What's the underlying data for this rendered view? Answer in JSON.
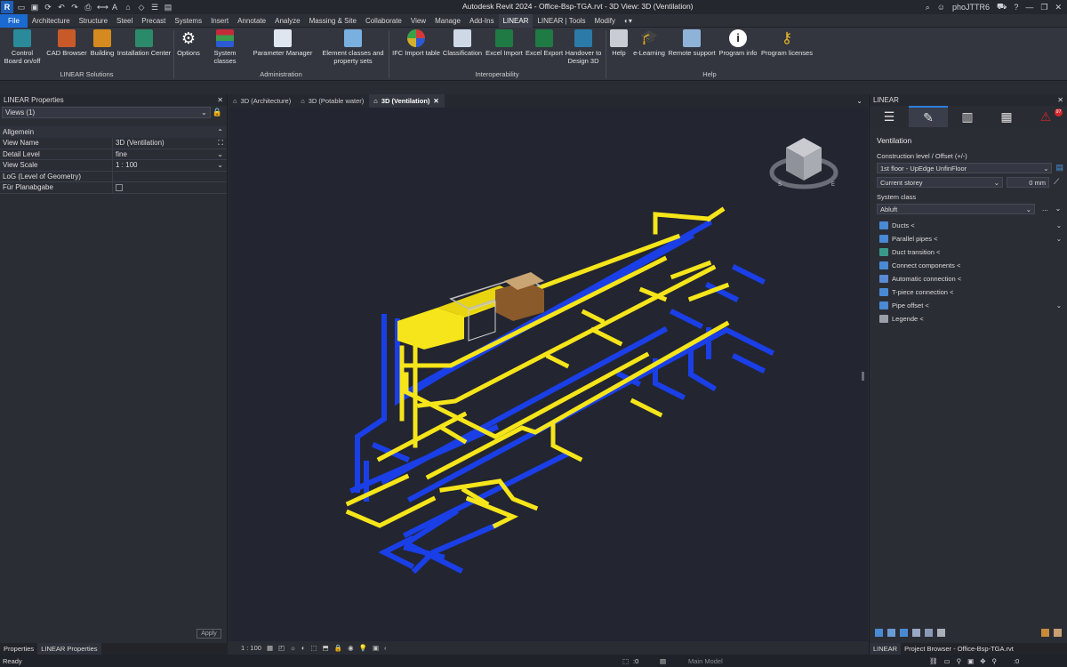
{
  "app": {
    "logo": "R",
    "title": "Autodesk Revit 2024 - Office-Bsp-TGA.rvt - 3D View: 3D (Ventilation)",
    "user": "phoJTTR6"
  },
  "menu": [
    "File",
    "Architecture",
    "Structure",
    "Steel",
    "Precast",
    "Systems",
    "Insert",
    "Annotate",
    "Analyze",
    "Massing & Site",
    "Collaborate",
    "View",
    "Manage",
    "Add-Ins",
    "LINEAR",
    "LINEAR | Tools",
    "Modify"
  ],
  "ribbon": {
    "buttons": [
      {
        "label": "Control Board on/off"
      },
      {
        "label": "CAD Browser"
      },
      {
        "label": "Building"
      },
      {
        "label": "Installation Center"
      },
      {
        "label": "Options"
      },
      {
        "label": "System classes"
      },
      {
        "label": "Parameter Manager"
      },
      {
        "label": "Element classes and property sets"
      },
      {
        "label": "IFC Import table"
      },
      {
        "label": "Classification"
      },
      {
        "label": "Excel Import"
      },
      {
        "label": "Excel Export"
      },
      {
        "label": "Handover to Design 3D"
      },
      {
        "label": "Help"
      },
      {
        "label": "e-Learning"
      },
      {
        "label": "Remote support"
      },
      {
        "label": "Program info"
      },
      {
        "label": "Program licenses"
      }
    ],
    "panels": {
      "solutions": "LINEAR Solutions",
      "administration": "Administration",
      "interoperability": "Interoperability",
      "help": "Help"
    }
  },
  "left": {
    "title": "LINEAR Properties",
    "views_dd": "Views (1)",
    "group": "Allgemein",
    "props": [
      {
        "k": "View Name",
        "v": "3D (Ventilation)"
      },
      {
        "k": "Detail Level",
        "v": "fine"
      },
      {
        "k": "View Scale",
        "v": "1 : 100"
      },
      {
        "k": "LoG (Level of Geometry)",
        "v": ""
      },
      {
        "k": "Für Planabgabe",
        "v": ""
      }
    ],
    "apply": "Apply",
    "tabs": [
      "Properties",
      "LINEAR Properties"
    ]
  },
  "viewtabs": [
    "3D (Architecture)",
    "3D (Potable water)",
    "3D (Ventilation)"
  ],
  "viewbar": {
    "scale": "1 : 100"
  },
  "right": {
    "title": "LINEAR",
    "badge": "97",
    "section": "Ventilation",
    "construction_label": "Construction level / Offset (+/-)",
    "floor": "1st floor - UpEdge UnfinFloor",
    "storey": "Current storey",
    "offset": "0 mm",
    "system_label": "System class",
    "system": "Abluft",
    "more": "...",
    "tools": [
      "Ducts <",
      "Parallel pipes <",
      "Duct transition <",
      "Connect components <",
      "Automatic connection <",
      "T-piece connection <",
      "Pipe offset <",
      "Legende <"
    ],
    "bottom_tabs": [
      "LINEAR",
      "Project Browser - Office-Bsp-TGA.rvt"
    ]
  },
  "status": {
    "ready": "Ready",
    "zero1": ":0",
    "model": "Main Model",
    "zero2": ":0"
  },
  "colors": {
    "accent": "#1b6ad1",
    "yellow": "#f5e51a",
    "blue": "#1a3fe6"
  }
}
